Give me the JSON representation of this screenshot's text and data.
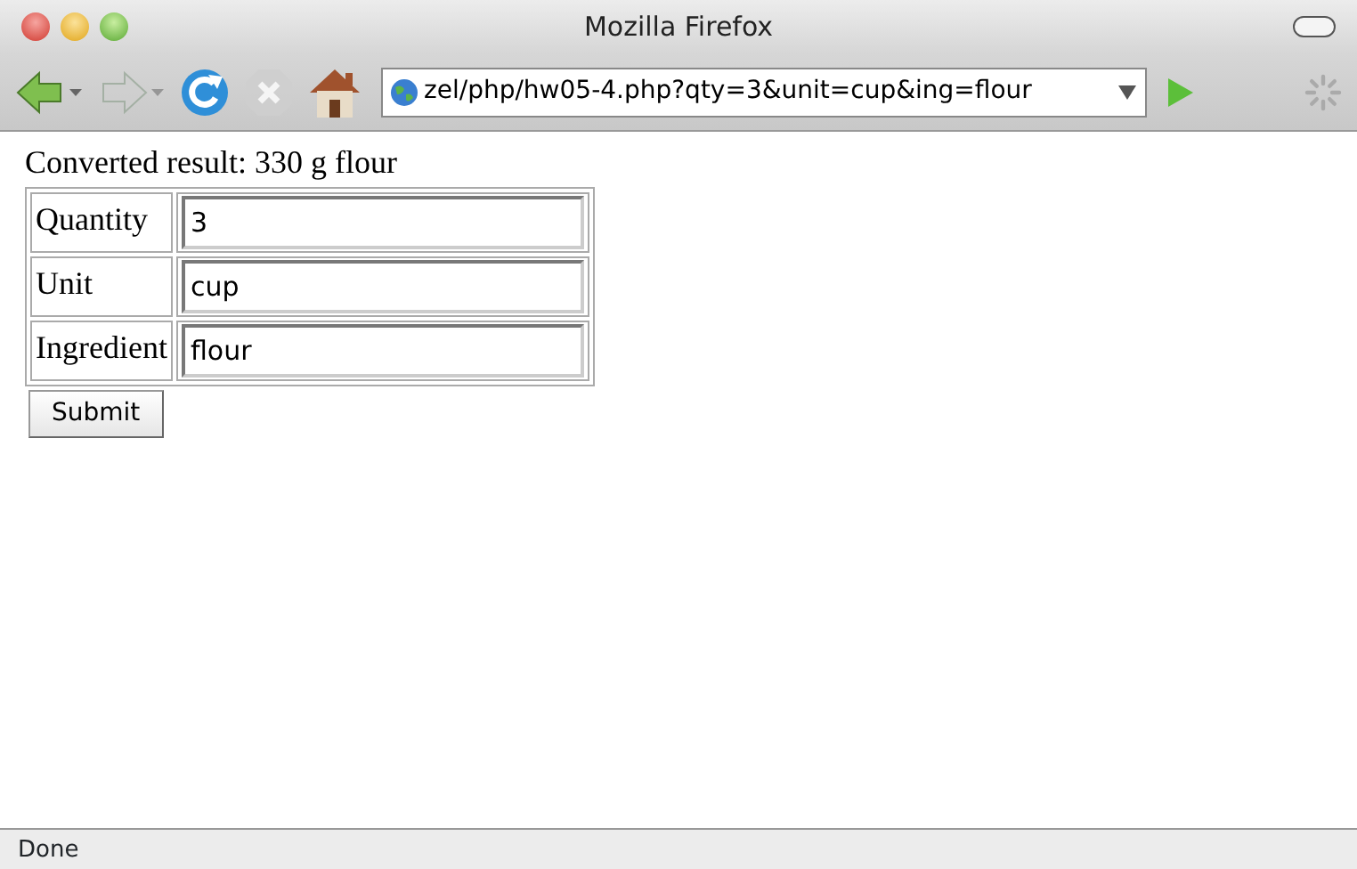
{
  "window": {
    "title": "Mozilla Firefox"
  },
  "toolbar": {
    "buttons": [
      {
        "kind": "back",
        "disabled": false
      },
      {
        "kind": "forward",
        "disabled": true
      },
      {
        "kind": "reload",
        "disabled": false
      },
      {
        "kind": "stop",
        "disabled": true
      },
      {
        "kind": "home",
        "disabled": false
      }
    ],
    "url": "zel/php/hw05-4.php?qty=3&unit=cup&ing=flour"
  },
  "page": {
    "result": "Converted result: 330 g flour",
    "form": [
      {
        "label": "Quantity",
        "value": "3"
      },
      {
        "label": "Unit",
        "value": "cup"
      },
      {
        "label": "Ingredient",
        "value": "flour"
      }
    ],
    "submit": "Submit"
  },
  "status_bar": {
    "text": "Done"
  }
}
